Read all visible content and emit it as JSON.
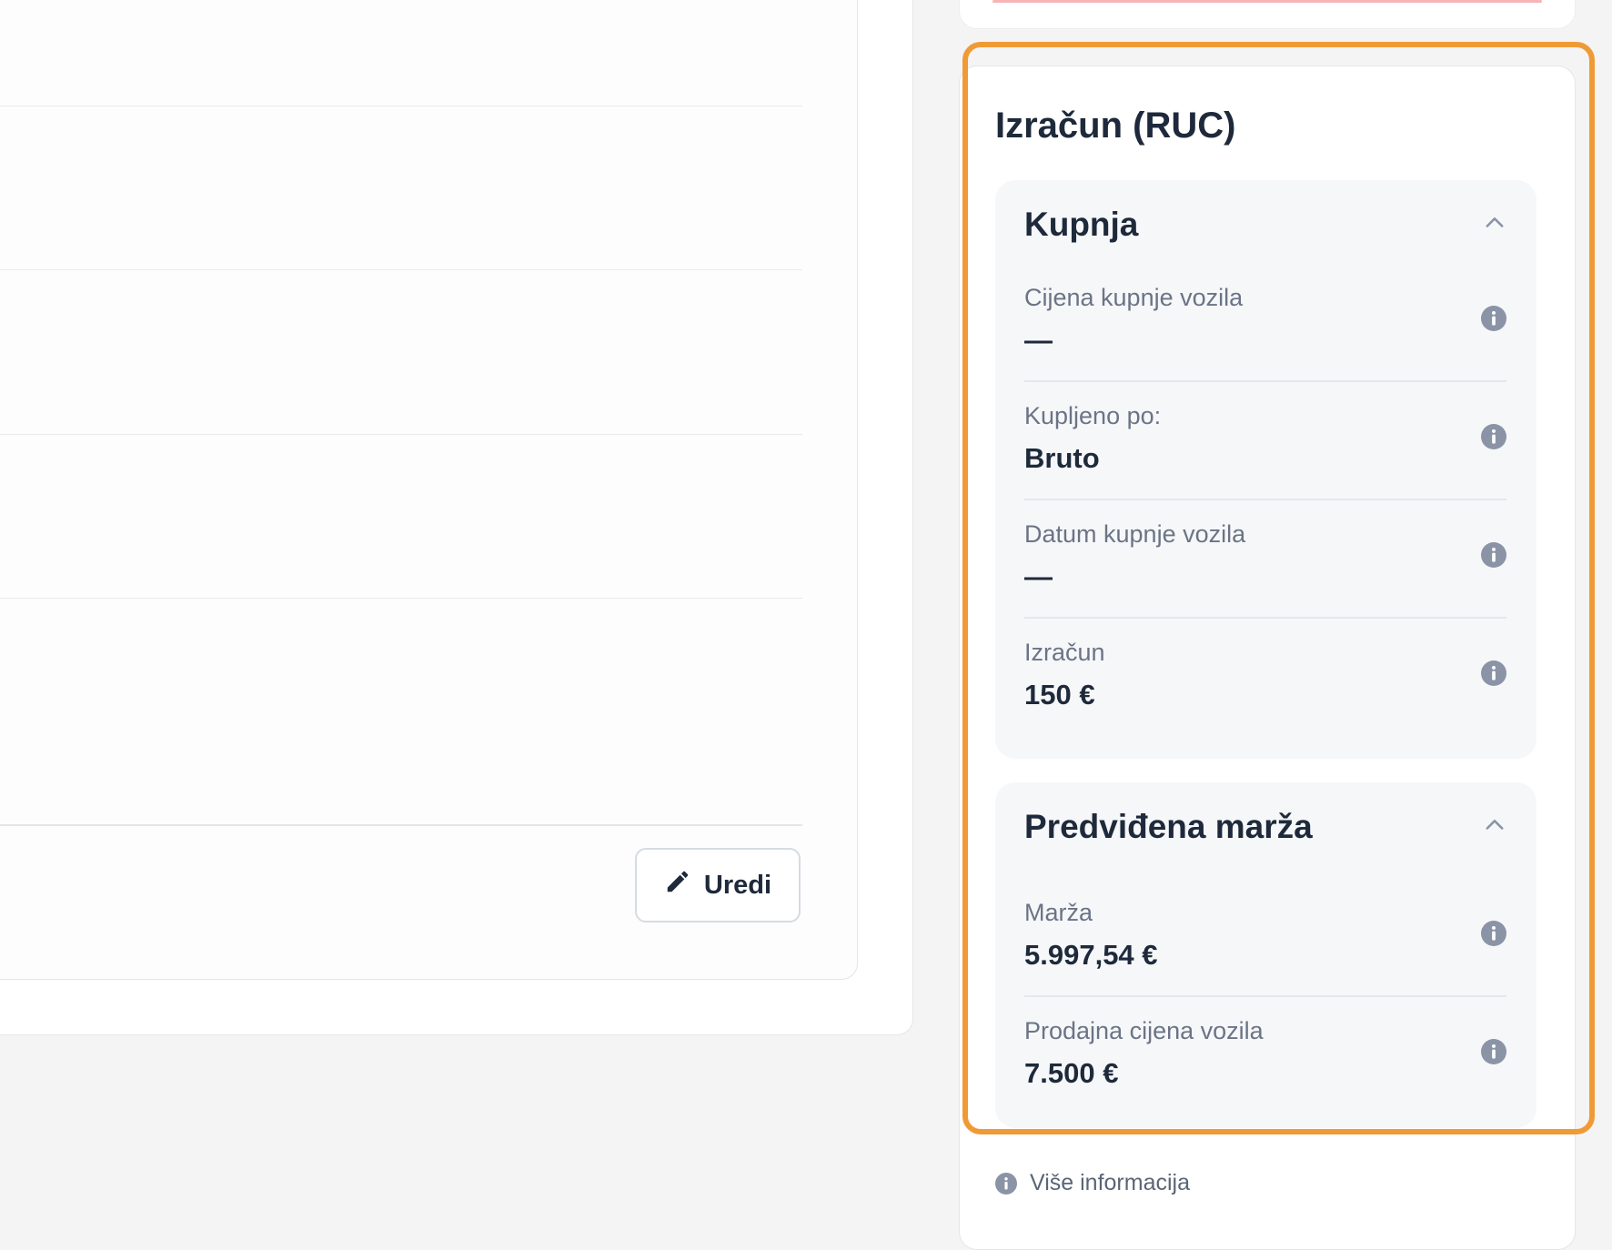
{
  "left_panel": {
    "edit_button_label": "Uredi"
  },
  "ruc": {
    "title": "Izračun (RUC)",
    "purchase": {
      "title": "Kupnja",
      "items": [
        {
          "label": "Cijena kupnje vozila",
          "value": "—"
        },
        {
          "label": "Kupljeno po:",
          "value": "Bruto"
        },
        {
          "label": "Datum kupnje vozila",
          "value": "—"
        },
        {
          "label": "Izračun",
          "value": "150 €"
        }
      ]
    },
    "margin": {
      "title": "Predviđena marža",
      "items": [
        {
          "label": "Marža",
          "value": "5.997,54 €"
        },
        {
          "label": "Prodajna cijena vozila",
          "value": "7.500 €"
        }
      ]
    },
    "more_info_label": "Više informacija"
  },
  "colors": {
    "highlight": "#f09a36",
    "text_primary": "#1e2a3b",
    "text_secondary": "#6b7486",
    "info_icon": "#8a94a6"
  },
  "icons": {
    "edit": "pencil-icon",
    "collapse": "chevron-up-icon",
    "info": "info-icon"
  }
}
